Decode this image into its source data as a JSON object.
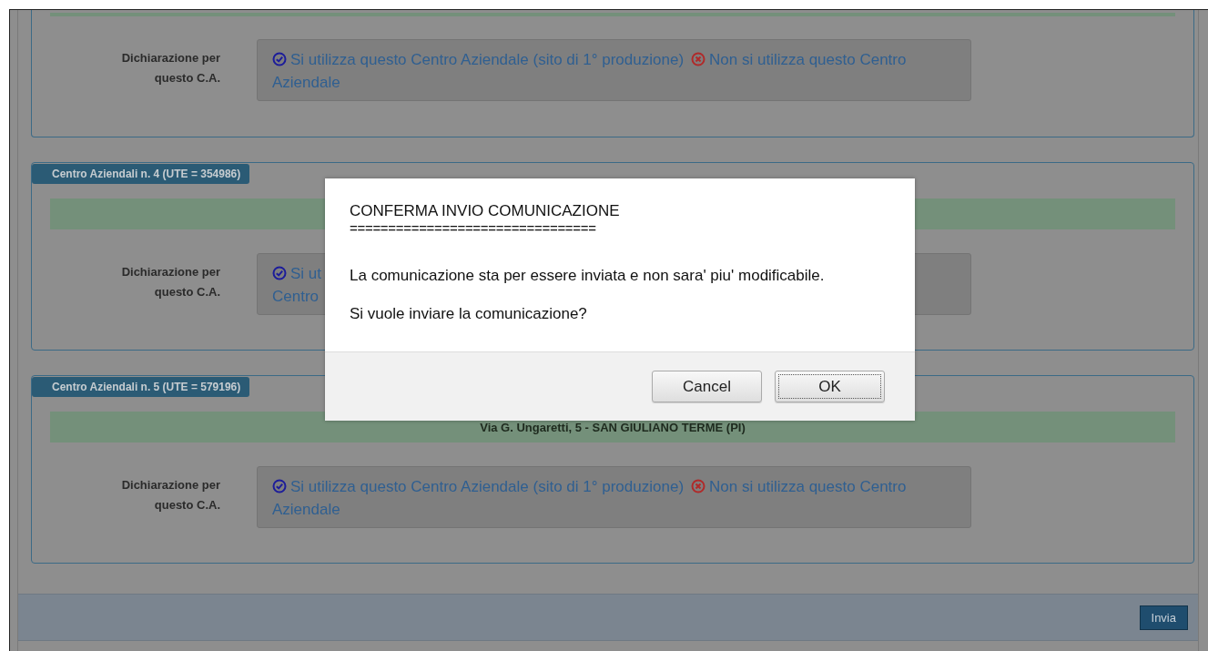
{
  "sections": [
    {
      "declaration": {
        "label": "Dichiarazione per questo C.A.",
        "options": [
          {
            "kind": "yes",
            "text": "Si utilizza questo Centro Aziendale (sito di 1° produzione)"
          },
          {
            "kind": "no",
            "text": "Non si utilizza questo Centro Aziendale"
          }
        ]
      }
    },
    {
      "legend": "Centro Aziendali n. 4 (UTE = 354986)",
      "declaration": {
        "label": "Dichiarazione per questo C.A.",
        "options": [
          {
            "kind": "yes",
            "text": "Si ut"
          }
        ],
        "continuation": "Centro"
      }
    },
    {
      "legend": "Centro Aziendali n. 5 (UTE = 579196)",
      "address": "Via G. Ungaretti, 5 - SAN GIULIANO TERME (PI)",
      "declaration": {
        "label": "Dichiarazione per questo C.A.",
        "options": [
          {
            "kind": "yes",
            "text": "Si utilizza questo Centro Aziendale (sito di 1° produzione)"
          },
          {
            "kind": "no",
            "text": "Non si utilizza questo Centro Aziendale"
          }
        ]
      }
    }
  ],
  "footer": {
    "submit_button": "Invia"
  },
  "dialog": {
    "title": "CONFERMA INVIO COMUNICAZIONE",
    "separator": "================================",
    "message": "La comunicazione sta per essere inviata e non sara' piu' modificabile.",
    "question": "Si vuole inviare la comunicazione?",
    "buttons": [
      {
        "label": "Cancel",
        "focused": false
      },
      {
        "label": "OK",
        "focused": true
      }
    ]
  }
}
